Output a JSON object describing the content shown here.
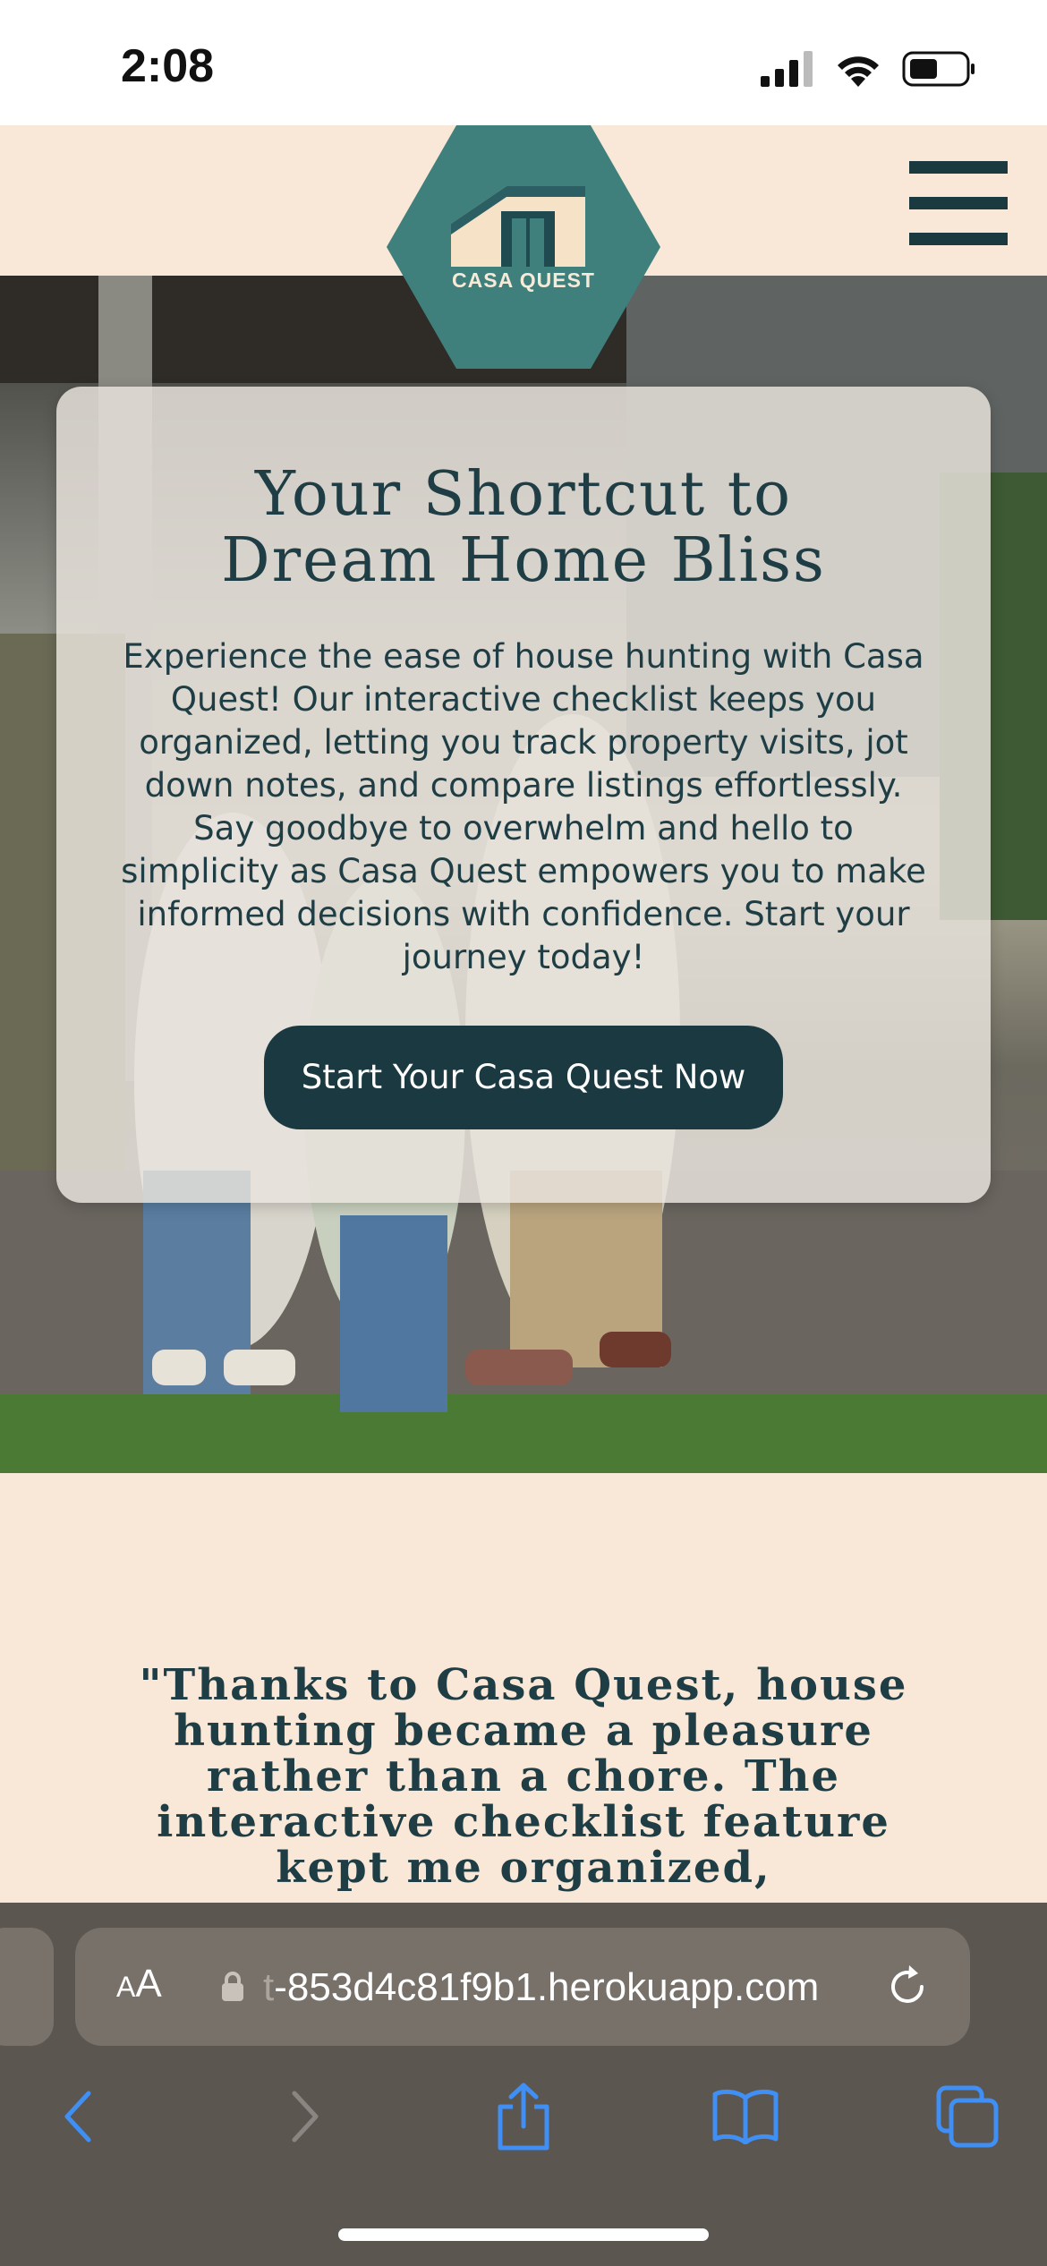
{
  "status_bar": {
    "time": "2:08"
  },
  "site": {
    "logo_text": "CASA QUEST",
    "colors": {
      "teal": "#3f7f7c",
      "navy": "#1a3940",
      "cream": "#f9e8d8"
    }
  },
  "hero": {
    "title_line1": "Your Shortcut to",
    "title_line2": "Dream Home Bliss",
    "description": "Experience the ease of house hunting with Casa Quest! Our interactive checklist keeps you organized, letting you track property visits, jot down notes, and compare listings effortlessly. Say goodbye to overwhelm and hello to simplicity as Casa Quest empowers you to make informed decisions with confidence. Start your journey today!",
    "cta_label": "Start Your Casa Quest Now"
  },
  "testimonial": {
    "quote": "\"Thanks to Casa Quest, house hunting became a pleasure rather than a chore. The interactive checklist feature kept me organized,"
  },
  "browser": {
    "aa_small": "A",
    "aa_large": "A",
    "url_faded": "t",
    "url": "-853d4c81f9b1.herokuapp.com"
  }
}
